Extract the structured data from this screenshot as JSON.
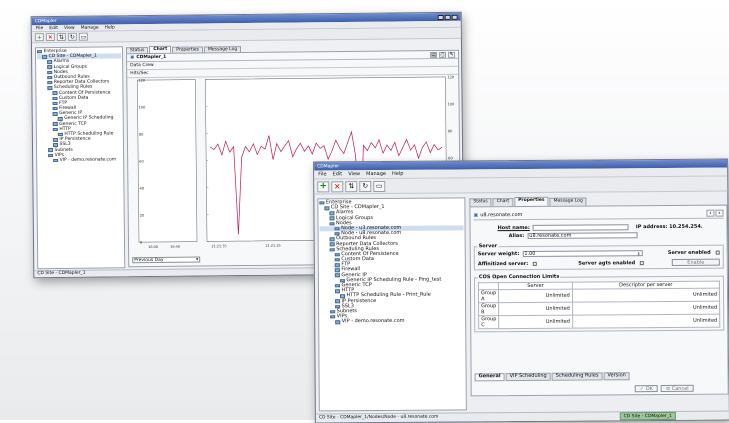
{
  "back": {
    "title": "CDMapler",
    "menu": [
      "File",
      "Edit",
      "View",
      "Manage",
      "Help"
    ],
    "tree": [
      "Enterprise",
      "CD Site - CDMapler_1",
      "Alarms",
      "Logical Groups",
      "Nodes",
      "Outbound Rules",
      "Reporter Data Collectors",
      "Scheduling Rules",
      "Content Of Persistence",
      "Custom Data",
      "FTP",
      "Firewall",
      "Generic IP",
      "Generic IP Scheduling",
      "Generic TCP",
      "HTTP",
      "HTTP Scheduling Rule",
      "IP Persistence",
      "SSL3",
      "Subnets",
      "VIPs",
      "VIP - demo.resonate.com"
    ],
    "tabs": [
      "Status",
      "Chart",
      "Properties",
      "Message Log"
    ],
    "panel_title": "CDMapler_1",
    "series_rows": [
      "Data Crew",
      "Hits/Sec"
    ],
    "period": "Previous Day",
    "status": "CD Site - CDMapler_1"
  },
  "chart_data": {
    "type": "line",
    "xlabel": "",
    "ylabel": "",
    "x_ticks": [
      "16:00",
      "16:40",
      "21:21:35",
      "21:21:35",
      "21:21:35",
      "21:21:35",
      "21:21:35"
    ],
    "y_ticks": [
      "120",
      "100",
      "80",
      "60",
      "40",
      "20",
      "0"
    ],
    "ylim": [
      0,
      120
    ],
    "series": [
      {
        "color": "#c2185b",
        "values": [
          70,
          68,
          72,
          64,
          74,
          66,
          70,
          5,
          62,
          70,
          66,
          72,
          64,
          70,
          68,
          78,
          60,
          72,
          66,
          70,
          74,
          62,
          68,
          72,
          66,
          70,
          64,
          72,
          68,
          70,
          60,
          66,
          74,
          68,
          64,
          72,
          80,
          62,
          0,
          70,
          66,
          72,
          68,
          74,
          64,
          70,
          66,
          72,
          62,
          68,
          74,
          66,
          70,
          60,
          68,
          72,
          64,
          70,
          66,
          68
        ]
      }
    ]
  },
  "front": {
    "title": "CDMapler",
    "menu": [
      "File",
      "Edit",
      "View",
      "Manage",
      "Help"
    ],
    "tree": [
      "Enterprise",
      "CD Site - CDMapler_1",
      "Alarms",
      "Logical Groups",
      "Nodes",
      "Node - u3.resonate.com",
      "Node - u8.resonate.com",
      "Outbound Rules",
      "Reporter Data Collectors",
      "Scheduling Rules",
      "Content Of Persistence",
      "Custom Data",
      "FTP",
      "Firewall",
      "Generic IP",
      "Generic IP Scheduling Rule - Ping_test",
      "Generic TCP",
      "HTTP",
      "HTTP Scheduling Rule - Print_Rule",
      "IP Persistence",
      "SSL3",
      "Subnets",
      "VIPs",
      "VIP - demo.resonate.com"
    ],
    "tabs": [
      "Status",
      "Chart",
      "Properties",
      "Message Log"
    ],
    "node_title": "u8.resonate.com",
    "host_label": "Host name:",
    "ip_label": "IP address: 10.254.254.",
    "alias_label": "Alias:",
    "alias_value": "u8.resonate.com",
    "server_legend": "Server",
    "weight_label": "Server weight:",
    "weight_value": "1.00",
    "affinitized_label": "Affinitized server:",
    "agts_label": "Server agts enabled",
    "enabled_label": "Server enabled",
    "enable_button": "Enable",
    "cos_legend": "COS Open Connection Limits",
    "cos_headers": [
      "",
      "Server",
      "Descriptor per server"
    ],
    "cos_rows": [
      [
        "Group A",
        "Unlimited",
        "Unlimited"
      ],
      [
        "Group B",
        "Unlimited",
        "Unlimited"
      ],
      [
        "Group C",
        "Unlimited",
        "Unlimited"
      ]
    ],
    "bottom_tabs": [
      "General",
      "VIP Scheduling",
      "Scheduling Rules",
      "Version"
    ],
    "ok_button": "OK",
    "cancel_button": "Cancel",
    "status_left": "CD Site - CDMapler_1/Nodes/Node - u8.resonate.com",
    "status_right": "CD Site - CDMapler_1"
  }
}
